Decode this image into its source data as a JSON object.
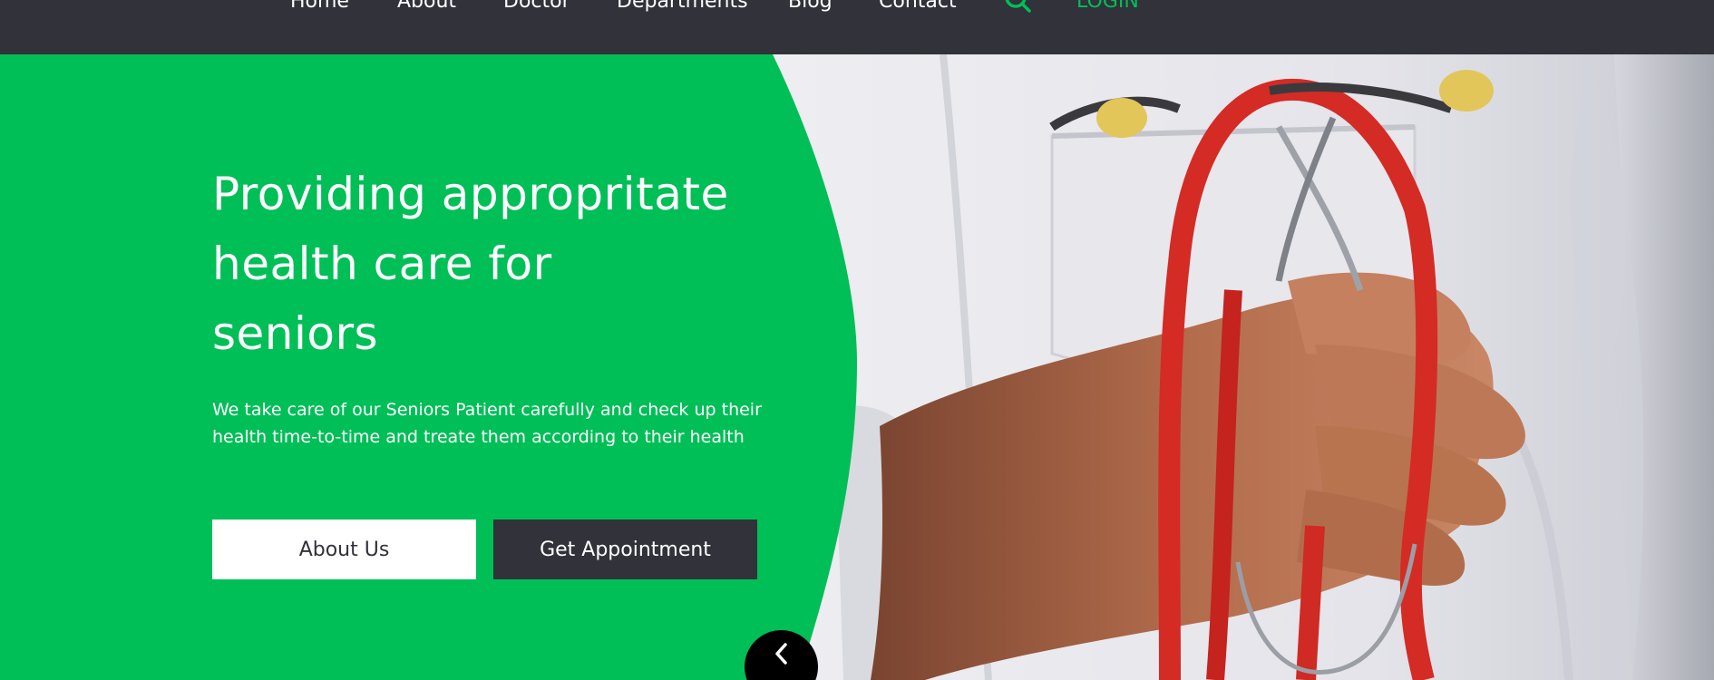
{
  "nav": {
    "items": [
      "Home",
      "About",
      "Doctor",
      "Departments",
      "Blog",
      "Contact"
    ],
    "search_icon": "search-icon",
    "login": "LOGIN"
  },
  "hero": {
    "title_lines": [
      "Providing appropritate",
      "health care for",
      "seniors"
    ],
    "description_lines": [
      "We take care of our Seniors Patient carefully and check up their",
      "health time-to-time and treate them according to their health"
    ],
    "about_button": "About Us",
    "appointment_button": "Get Appointment",
    "prev_icon": "chevron-left-icon"
  },
  "colors": {
    "navbar": "#31323a",
    "accent_green": "#00bf57",
    "white": "#ffffff",
    "dark_button": "#31323a",
    "arrow_circle": "#000000"
  }
}
